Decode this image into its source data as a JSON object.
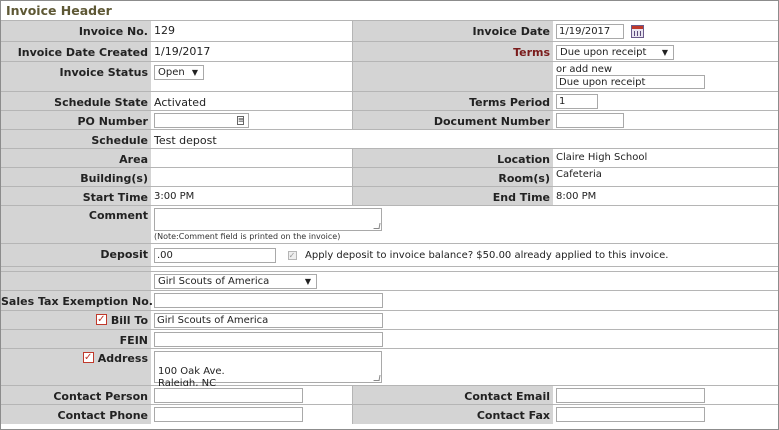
{
  "header": {
    "title": "Invoice Header"
  },
  "fields": {
    "invoice_no": {
      "label": "Invoice No.",
      "value": "129"
    },
    "invoice_date": {
      "label": "Invoice Date",
      "value": "1/19/2017"
    },
    "invoice_date_created": {
      "label": "Invoice Date Created",
      "value": "1/19/2017"
    },
    "terms": {
      "label": "Terms",
      "value": "Due upon receipt",
      "add_new_text": "or add new",
      "new_value": "Due upon receipt"
    },
    "invoice_status": {
      "label": "Invoice Status",
      "value": "Open"
    },
    "schedule_state": {
      "label": "Schedule State",
      "value": "Activated"
    },
    "terms_period": {
      "label": "Terms Period",
      "value": "1"
    },
    "po_number": {
      "label": "PO Number",
      "value": ""
    },
    "document_number": {
      "label": "Document Number",
      "value": ""
    },
    "schedule": {
      "label": "Schedule",
      "value": "Test depost"
    },
    "area": {
      "label": "Area",
      "value": ""
    },
    "location": {
      "label": "Location",
      "value": "Claire High School"
    },
    "buildings": {
      "label": "Building(s)",
      "value": ""
    },
    "rooms": {
      "label": "Room(s)",
      "value": "Cafeteria"
    },
    "start_time": {
      "label": "Start Time",
      "value": "3:00 PM"
    },
    "end_time": {
      "label": "End Time",
      "value": "8:00 PM"
    },
    "comment": {
      "label": "Comment",
      "value": "",
      "note": "(Note:Comment field is printed on the invoice)"
    },
    "deposit": {
      "label": "Deposit",
      "value": ".00",
      "apply_text": "Apply deposit to invoice balance? $50.00 already applied to this invoice."
    },
    "customer": {
      "value": "Girl Scouts of America"
    },
    "sales_tax": {
      "label": "Sales Tax Exemption No.",
      "value": ""
    },
    "bill_to": {
      "label": "Bill To",
      "value": "Girl Scouts of America"
    },
    "fein": {
      "label": "FEIN",
      "value": ""
    },
    "address": {
      "label": "Address",
      "value": "100 Oak Ave.\nRaleigh, NC"
    },
    "contact_person": {
      "label": "Contact Person",
      "value": ""
    },
    "contact_email": {
      "label": "Contact Email",
      "value": ""
    },
    "contact_phone": {
      "label": "Contact Phone",
      "value": ""
    },
    "contact_fax": {
      "label": "Contact Fax",
      "value": ""
    }
  },
  "icons": {
    "calendar": "calendar-icon",
    "dropdown": "chevron-down-icon",
    "lookup": "lookup-icon",
    "check": "✓"
  }
}
